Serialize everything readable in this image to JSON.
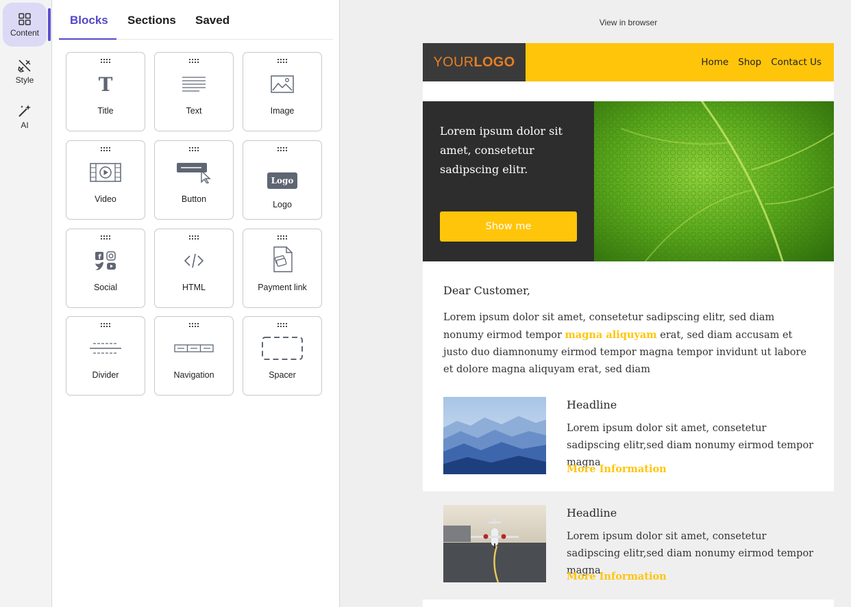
{
  "rail": {
    "items": [
      {
        "label": "Content",
        "icon": "grid-icon",
        "active": true
      },
      {
        "label": "Style",
        "icon": "style-brush-icon"
      },
      {
        "label": "AI",
        "icon": "magic-wand-icon"
      }
    ]
  },
  "panel": {
    "tabs": [
      {
        "label": "Blocks",
        "active": true
      },
      {
        "label": "Sections"
      },
      {
        "label": "Saved"
      }
    ],
    "blocks": [
      {
        "label": "Title",
        "icon": "title-icon"
      },
      {
        "label": "Text",
        "icon": "text-lines-icon"
      },
      {
        "label": "Image",
        "icon": "image-icon"
      },
      {
        "label": "Video",
        "icon": "video-icon"
      },
      {
        "label": "Button",
        "icon": "button-cursor-icon"
      },
      {
        "label": "Logo",
        "icon": "logo-icon",
        "badge": "Logo"
      },
      {
        "label": "Social",
        "icon": "social-icons-icon"
      },
      {
        "label": "HTML",
        "icon": "code-icon"
      },
      {
        "label": "Payment link",
        "icon": "payment-link-icon"
      },
      {
        "label": "Divider",
        "icon": "divider-icon"
      },
      {
        "label": "Navigation",
        "icon": "navigation-icon"
      },
      {
        "label": "Spacer",
        "icon": "spacer-icon"
      }
    ]
  },
  "email": {
    "view_in_browser": "View in browser",
    "logo_part1": "YOUR",
    "logo_part2": "LOGO",
    "nav": [
      "Home",
      "Shop",
      "Contact Us"
    ],
    "hero_text": "Lorem ipsum dolor sit amet, consetetur sadipscing elitr.",
    "hero_button": "Show me",
    "greeting": "Dear Customer,",
    "para_before": "Lorem ipsum dolor sit amet, consetetur sadipscing elitr, sed diam nonumy eirmod tempor ",
    "para_highlight": "magna aliquyam",
    "para_after": " erat, sed diam accusam et justo duo diamnonumy eirmod tempor magna tempor invidunt ut labore et dolore magna aliquyam erat, sed diam",
    "articles": [
      {
        "headline": "Headline",
        "text": "Lorem ipsum dolor sit amet, consetetur sadipscing elitr,sed diam nonumy eirmod tempor magna",
        "link": "More Information",
        "image": "mountains-photo"
      },
      {
        "headline": "Headline",
        "text": "Lorem ipsum dolor sit amet, consetetur sadipscing elitr,sed diam nonumy eirmod tempor magna",
        "link": "More Information",
        "image": "jet-photo"
      }
    ]
  },
  "colors": {
    "accent": "#5446c9",
    "brand_yellow": "#ffc50b",
    "dark": "#2d2d2d",
    "logo_orange": "#e87f23"
  }
}
